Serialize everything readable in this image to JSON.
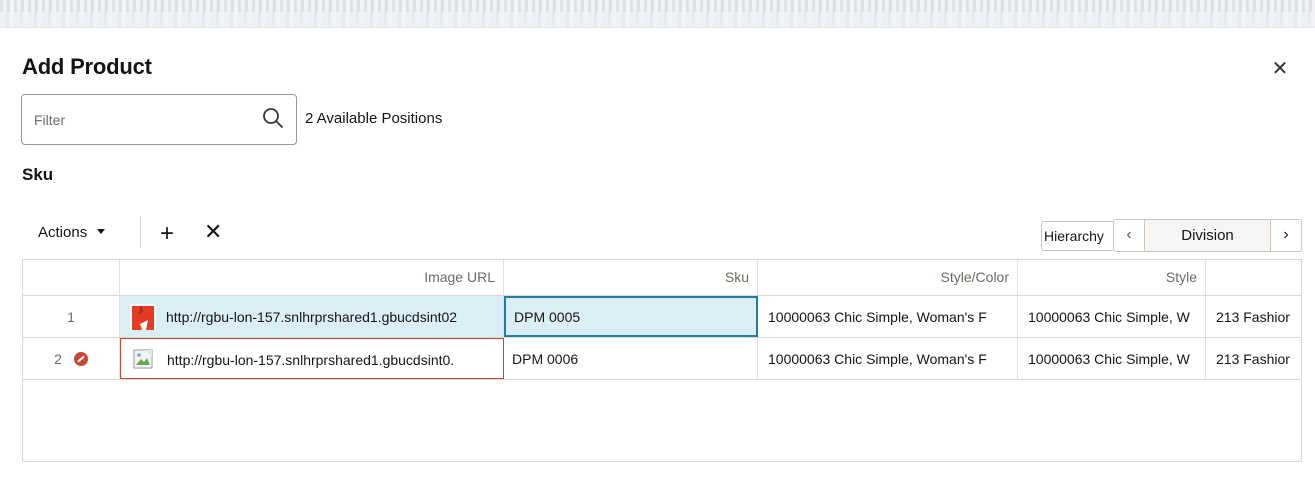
{
  "dialog": {
    "title": "Add Product",
    "close_icon": "close-icon"
  },
  "filter": {
    "placeholder": "Filter",
    "value": "",
    "icon": "search-icon",
    "available_positions": "2 Available Positions"
  },
  "section": {
    "title": "Sku"
  },
  "toolbar": {
    "actions_label": "Actions",
    "add_symbol": "+",
    "remove_symbol": "✕",
    "hierarchy_label": "Hierarchy",
    "hierarchy_prev": "‹",
    "hierarchy_value": "Division",
    "hierarchy_next": "›"
  },
  "table": {
    "columns": [
      "",
      "Image URL",
      "Sku",
      "Style/Color",
      "Style",
      ""
    ],
    "rows": [
      {
        "num": "1",
        "image_url": "http://rgbu-lon-157.snlhrprshared1.gbucdsint02",
        "sku": "DPM 0005",
        "style_color": "10000063 Chic Simple, Woman's F",
        "style": "10000063 Chic Simple, W",
        "extra": "213 Fashior",
        "status": "selected"
      },
      {
        "num": "2",
        "image_url": "http://rgbu-lon-157.snlhrprshared1.gbucdsint0.",
        "sku": "DPM 0006",
        "style_color": "10000063 Chic Simple, Woman's F",
        "style": "10000063 Chic Simple, W",
        "extra": "213 Fashior",
        "status": "error"
      }
    ]
  },
  "colors": {
    "selected_bg": "#dbeef6",
    "focus_border": "#227e9e",
    "error": "#c74634"
  }
}
